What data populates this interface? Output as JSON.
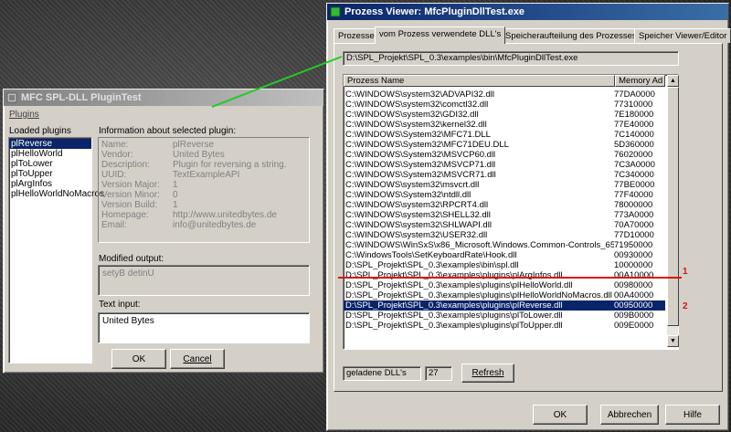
{
  "left_window": {
    "title": "MFC SPL-DLL PluginTest",
    "menu": "Plugins",
    "loaded_plugins_label": "Loaded plugins",
    "plugins": [
      "plReverse",
      "plHelloWorld",
      "plToLower",
      "plToUpper",
      "plArgInfos",
      "plHelloWorldNoMacros"
    ],
    "selected_plugin_index": 0,
    "info_label": "Information about selected plugin:",
    "info": [
      {
        "key": "Name:",
        "value": "plReverse"
      },
      {
        "key": "Vendor:",
        "value": "United Bytes"
      },
      {
        "key": "Description:",
        "value": "Plugin for reversing a string."
      },
      {
        "key": "UUID:",
        "value": "TextExampleAPI"
      },
      {
        "key": "Version Major:",
        "value": "1"
      },
      {
        "key": "Version Minor:",
        "value": "0"
      },
      {
        "key": "Version Build:",
        "value": "1"
      },
      {
        "key": "Homepage:",
        "value": "http://www.unitedbytes.de"
      },
      {
        "key": "Email:",
        "value": "info@unitedbytes.de"
      }
    ],
    "modified_output_label": "Modified output:",
    "modified_output_value": "setyB detinU",
    "text_input_label": "Text input:",
    "text_input_value": "United Bytes",
    "ok_label": "OK",
    "cancel_label": "Cancel"
  },
  "right_window": {
    "title": "Prozess Viewer: MfcPluginDllTest.exe",
    "tabs": [
      "Prozesse",
      "vom Prozess verwendete DLL's",
      "Speicheraufteilung des Prozesses",
      "Speicher Viewer/Editor"
    ],
    "active_tab_index": 1,
    "path": "D:\\SPL_Projekt\\SPL_0.3\\examples\\bin\\MfcPluginDllTest.exe",
    "columns": [
      "Prozess Name",
      "Memory Ad"
    ],
    "rows": [
      {
        "name": "C:\\WINDOWS\\system32\\ADVAPI32.dll",
        "addr": "77DA0000"
      },
      {
        "name": "C:\\WINDOWS\\system32\\comctl32.dll",
        "addr": "77310000"
      },
      {
        "name": "C:\\WINDOWS\\system32\\GDI32.dll",
        "addr": "7E180000"
      },
      {
        "name": "C:\\WINDOWS\\system32\\kernel32.dll",
        "addr": "77E40000"
      },
      {
        "name": "C:\\WINDOWS\\System32\\MFC71.DLL",
        "addr": "7C140000"
      },
      {
        "name": "C:\\WINDOWS\\System32\\MFC71DEU.DLL",
        "addr": "5D360000"
      },
      {
        "name": "C:\\WINDOWS\\System32\\MSVCP60.dll",
        "addr": "76020000"
      },
      {
        "name": "C:\\WINDOWS\\System32\\MSVCP71.dll",
        "addr": "7C3A0000"
      },
      {
        "name": "C:\\WINDOWS\\System32\\MSVCR71.dll",
        "addr": "7C340000"
      },
      {
        "name": "C:\\WINDOWS\\system32\\msvcrt.dll",
        "addr": "77BE0000"
      },
      {
        "name": "C:\\WINDOWS\\System32\\ntdll.dll",
        "addr": "77F40000"
      },
      {
        "name": "C:\\WINDOWS\\system32\\RPCRT4.dll",
        "addr": "78000000"
      },
      {
        "name": "C:\\WINDOWS\\system32\\SHELL32.dll",
        "addr": "773A0000"
      },
      {
        "name": "C:\\WINDOWS\\system32\\SHLWAPI.dll",
        "addr": "70A70000"
      },
      {
        "name": "C:\\WINDOWS\\system32\\USER32.dll",
        "addr": "77D10000"
      },
      {
        "name": "C:\\WINDOWS\\WinSxS\\x86_Microsoft.Windows.Common-Controls_659...",
        "addr": "71950000"
      },
      {
        "name": "C:\\WindowsTools\\SetKeyboardRate\\Hook.dll",
        "addr": "00930000"
      },
      {
        "name": "D:\\SPL_Projekt\\SPL_0.3\\examples\\bin\\spl.dll",
        "addr": "10000000"
      },
      {
        "name": "D:\\SPL_Projekt\\SPL_0.3\\examples\\plugins\\plArgInfos.dll",
        "addr": "00A10000"
      },
      {
        "name": "D:\\SPL_Projekt\\SPL_0.3\\examples\\plugins\\plHelloWorld.dll",
        "addr": "00980000"
      },
      {
        "name": "D:\\SPL_Projekt\\SPL_0.3\\examples\\plugins\\plHelloWorldNoMacros.dll",
        "addr": "00A40000"
      },
      {
        "name": "D:\\SPL_Projekt\\SPL_0.3\\examples\\plugins\\plReverse.dll",
        "addr": "00950000"
      },
      {
        "name": "D:\\SPL_Projekt\\SPL_0.3\\examples\\plugins\\plToLower.dll",
        "addr": "009B0000"
      },
      {
        "name": "D:\\SPL_Projekt\\SPL_0.3\\examples\\plugins\\plToUpper.dll",
        "addr": "009E0000"
      }
    ],
    "selected_row_index": 21,
    "dll_count_label": "geladene DLL's",
    "dll_count_value": "27",
    "refresh_label": "Refresh",
    "ok_label": "OK",
    "cancel_label": "Abbrechen",
    "help_label": "Hilfe"
  },
  "annotations": {
    "marker_1": "1",
    "marker_2": "2",
    "connector_color": "#22cc22",
    "separator_color": "#dd1111"
  }
}
